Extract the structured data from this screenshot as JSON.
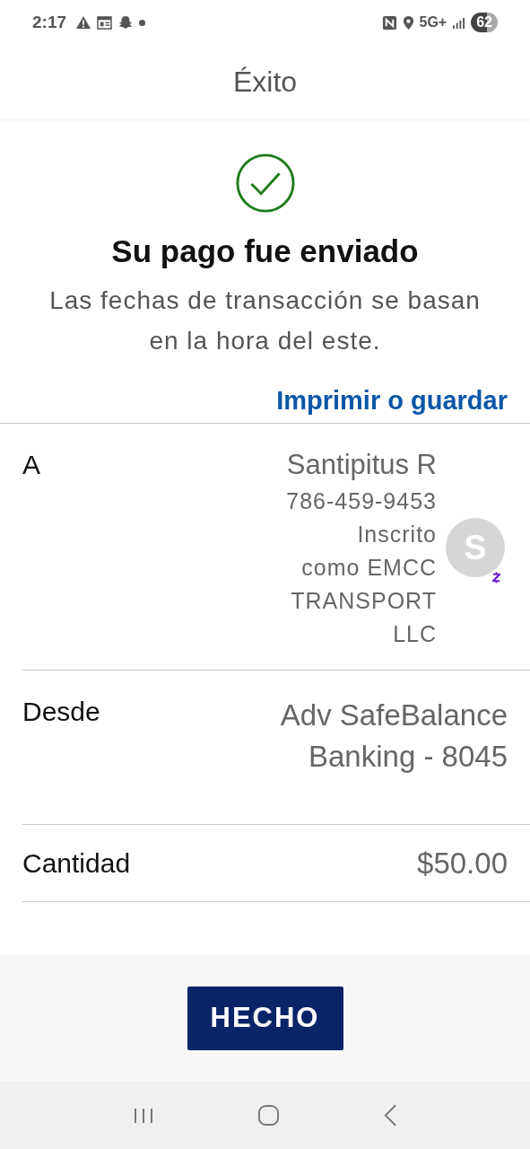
{
  "status_bar": {
    "time": "2:17",
    "network": "5G+",
    "battery": "62"
  },
  "header": {
    "title": "Éxito"
  },
  "confirmation": {
    "title": "Su pago fue enviado",
    "message": "Las fechas de transacción se basan en la hora del este.",
    "link": "Imprimir o guardar"
  },
  "details": [
    {
      "kind": "recipient",
      "label": "A",
      "name": "Santipitus R",
      "lines": [
        "786-459-9453",
        "Inscrito",
        "como EMCC",
        "TRANSPORT",
        "LLC"
      ],
      "avatar": "S"
    },
    {
      "kind": "account",
      "label": "Desde",
      "lines": [
        "Adv SafeBalance",
        "Banking - 8045"
      ]
    },
    {
      "kind": "amount",
      "label": "Cantidad",
      "lines": [
        "$50.00"
      ]
    }
  ],
  "button": "HECHO"
}
